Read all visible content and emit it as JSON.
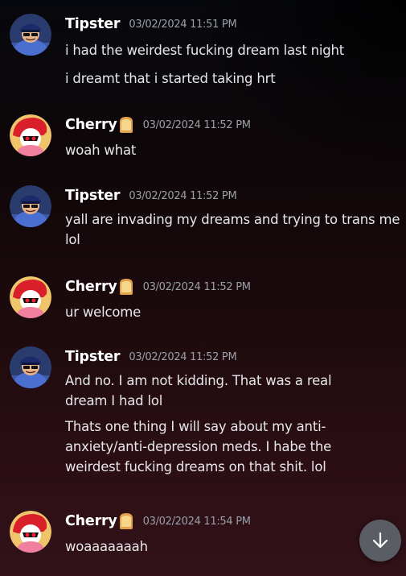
{
  "messages": [
    {
      "author": "Tipster",
      "timestamp": "03/02/2024 11:51 PM",
      "lines": [
        "i had the weirdest fucking dream last night",
        "i dreamt that i started taking hrt"
      ]
    },
    {
      "author": "Cherry",
      "timestamp": "03/02/2024 11:52 PM",
      "lines": [
        "woah what"
      ]
    },
    {
      "author": "Tipster",
      "timestamp": "03/02/2024 11:52 PM",
      "lines": [
        "yall are invading my dreams and trying to trans me lol"
      ]
    },
    {
      "author": "Cherry",
      "timestamp": "03/02/2024 11:52 PM",
      "lines": [
        "ur welcome"
      ]
    },
    {
      "author": "Tipster",
      "timestamp": "03/02/2024 11:52 PM",
      "lines": [
        "And no. I am not kidding. That was a real dream I had lol",
        "Thats one thing I will say about my anti-anxiety/anti-depression meds. I habe the weirdest fucking dreams on that shit. lol"
      ]
    },
    {
      "author": "Cherry",
      "timestamp": "03/02/2024 11:54 PM",
      "lines": [
        "woaaaaaaah"
      ]
    }
  ],
  "icons": {
    "badge": "bread-emoji-icon",
    "scroll": "arrow-down-icon"
  },
  "colors": {
    "username": "#ffffff",
    "timestamp": "#9aa0a8",
    "message_text": "#e6e7ea",
    "scroll_button": "#5a5d63"
  }
}
